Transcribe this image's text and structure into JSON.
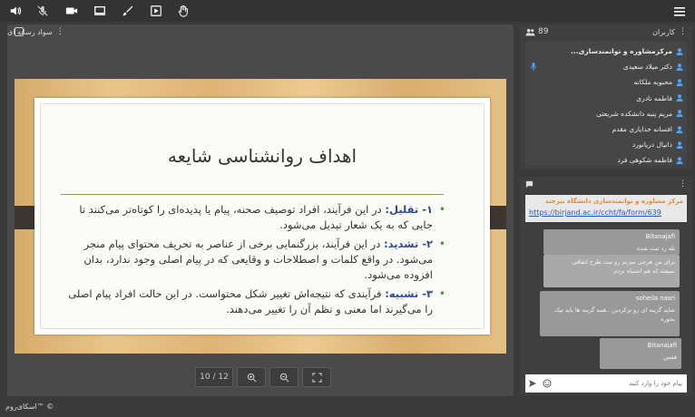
{
  "toolbar": {
    "icons": [
      "speaker-icon",
      "mic-muted-icon",
      "camera-icon",
      "screen-share-icon",
      "brush-icon",
      "play-media-icon",
      "raise-hand-icon"
    ],
    "menu_icon": "hamburger-icon"
  },
  "presentation": {
    "panel_title": "سواد رسانه ای",
    "slide_title": "اهداف روانشناسی شایعه",
    "bullets": [
      {
        "keyword": "۱- تقلیل:",
        "text": " در این فرآیند، افراد توصیف صحنه، پیام یا پدیده‌ای را کوتاه‌تر می‌کنند تا جایی که به یک شعار تبدیل می‌شود."
      },
      {
        "keyword": "۲- تشدید:",
        "text": " در این فرآیند، بزرگنمایی برخی از عناصر به تحریف محتوای پیام منجر می‌شود. در واقع کلمات و اصطلاحات و وقایعی که در پیام اصلی وجود ندارد، بدان افزوده می‌شود."
      },
      {
        "keyword": "۳- تشبیه:",
        "text": " فرآیندی که نتیجه‌اش تغییر شکل محتواست. در این حالت افراد پیام اصلی را می‌گیرند اما معنی و نظم آن را تغییر می‌دهند."
      }
    ],
    "page_indicator": "10 / 12",
    "accent_color": "#2c4a9a"
  },
  "users": {
    "title": "کاربران",
    "count": "89",
    "list": [
      {
        "name": "مرکزمشاوره و توانمندسازی..."
      },
      {
        "name": "دکتر میلاد سعیدی",
        "mic": true
      },
      {
        "name": "محبوبه ملکانه"
      },
      {
        "name": "فاطمه نادری"
      },
      {
        "name": "مریم پنبه دانشکده شریعتی"
      },
      {
        "name": "افسانه خدایاری مقدم"
      },
      {
        "name": "دانیال دریانورد"
      },
      {
        "name": "فاطمه شکوهی فرد"
      }
    ],
    "user_color": "#4aa3ff"
  },
  "chat": {
    "banner_title": "مرکز مشاوره و توانمندسازی دانشگاه بیرجند",
    "banner_link": "https://birjand.ac.ir/ccht/fa/form/639",
    "messages": [
      {
        "sender": "Bitanajafi",
        "body": "بله زد ثبت شده"
      },
      {
        "sender": "",
        "body": "برای من هرچی میزنم رو ثبت طرح اتفاقی نمیفته.که هم اشتباه نزدم"
      },
      {
        "sender": "soheila nasri",
        "body": "شاید گزینه ای رو نزکردین ..همه گزینه ها باید تیک بخوره"
      },
      {
        "sender": "Bitanajafi",
        "body": "قفس"
      }
    ],
    "input_placeholder": "پیام خود را وارد کنید"
  },
  "footer": {
    "brand": "اسکای‌روم™ ©"
  }
}
